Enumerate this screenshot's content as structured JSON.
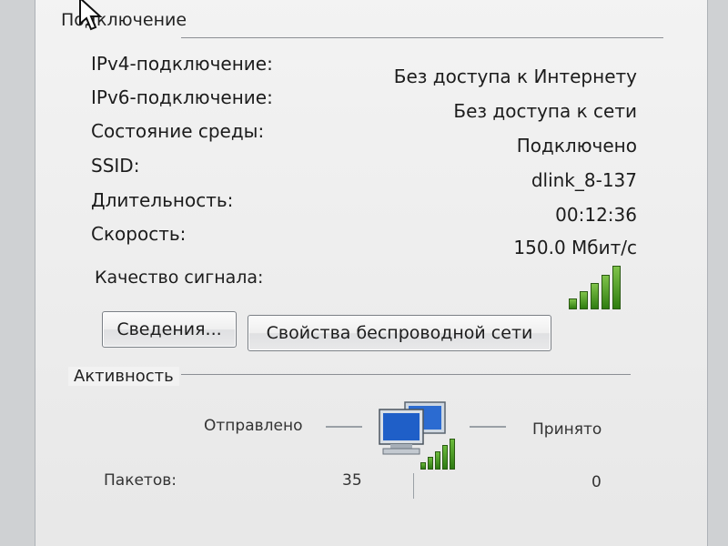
{
  "connection": {
    "group_title": "Подключение",
    "rows": [
      {
        "label": "IPv4-подключение:",
        "value": "Без доступа к Интернету"
      },
      {
        "label": "IPv6-подключение:",
        "value": "Без доступа к сети"
      },
      {
        "label": "Состояние среды:",
        "value": "Подключено"
      },
      {
        "label": "SSID:",
        "value": "dlink_8-137"
      },
      {
        "label": "Длительность:",
        "value": "00:12:36"
      },
      {
        "label": "Скорость:",
        "value": "150.0 Мбит/с"
      }
    ],
    "signal_label": "Качество сигнала:",
    "signal_level": {
      "bars_filled": 5,
      "bars_total": 5
    }
  },
  "buttons": {
    "details_label": "Сведения...",
    "wireless_props_label": "Свойства беспроводной сети"
  },
  "activity": {
    "group_title": "Активность",
    "sent_label": "Отправлено",
    "received_label": "Принято",
    "packets_label": "Пакетов:",
    "packets_sent": "35",
    "packets_received": "0"
  },
  "icons": {
    "signal": "signal-strength-icon",
    "network": "network-computers-icon",
    "cursor": "mouse-cursor-icon"
  },
  "colors": {
    "signal_green": "#2f7d10",
    "panel_bg": "#f2f2f2",
    "group_line": "#8c8f94"
  }
}
